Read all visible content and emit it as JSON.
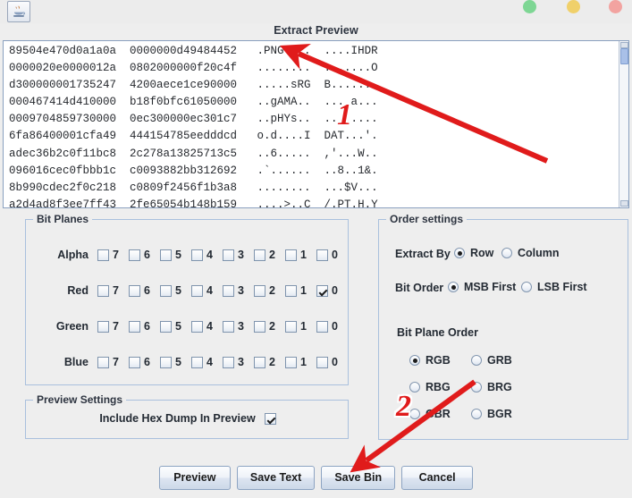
{
  "window": {
    "app_icon": "java-coffee-cup-icon",
    "controls": [
      {
        "name": "minimize",
        "color": "#7ed694"
      },
      {
        "name": "maximize",
        "color": "#f0d06a"
      },
      {
        "name": "close",
        "color": "#f2a3a0"
      }
    ]
  },
  "preview": {
    "title": "Extract Preview",
    "hex_lines": [
      "89504e470d0a1a0a  0000000d49484452   .PNG....  ....IHDR",
      "0000020e0000012a  0802000000f20c4f   ........  .......O",
      "d300000001735247  4200aece1ce90000   .....sRG  B.......",
      "000467414d410000  b18f0bfc61050000   ..gAMA..  ....a...",
      "0009704859730000  0ec300000ec301c7   ..pHYs..  ........",
      "6fa86400001cfa49  444154785eedddcd   o.d....I  DAT...'.",
      "adec36b2c0f11bc8  2c278a13825713c5   ..6.....  ,'...W..",
      "096016cec0fbbb1c  c0093882bb312692   .`......  ..8..1&.",
      "8b990cdec2f0c218  c0809f2456f1b3a8   ........  ...$V...",
      "a2d4ad8f3ee7ff43  2fe65054b148b159   ....>..C  /.PT.H.Y"
    ],
    "scrollbar": "vertical-scrollbar"
  },
  "bit_planes": {
    "legend": "Bit Planes",
    "bit_labels": [
      "7",
      "6",
      "5",
      "4",
      "3",
      "2",
      "1",
      "0"
    ],
    "channels": [
      {
        "label": "Alpha",
        "checked": [
          false,
          false,
          false,
          false,
          false,
          false,
          false,
          false
        ]
      },
      {
        "label": "Red",
        "checked": [
          false,
          false,
          false,
          false,
          false,
          false,
          false,
          true
        ]
      },
      {
        "label": "Green",
        "checked": [
          false,
          false,
          false,
          false,
          false,
          false,
          false,
          false
        ]
      },
      {
        "label": "Blue",
        "checked": [
          false,
          false,
          false,
          false,
          false,
          false,
          false,
          false
        ]
      }
    ]
  },
  "order_settings": {
    "legend": "Order settings",
    "extract_by": {
      "label": "Extract By",
      "options": [
        "Row",
        "Column"
      ],
      "selected": "Row"
    },
    "bit_order": {
      "label": "Bit Order",
      "options": [
        "MSB First",
        "LSB First"
      ],
      "selected": "MSB First"
    },
    "bit_plane_order": {
      "label": "Bit Plane Order",
      "options": [
        "RGB",
        "GRB",
        "RBG",
        "BRG",
        "GBR",
        "BGR"
      ],
      "selected": "RGB"
    }
  },
  "preview_settings": {
    "legend": "Preview Settings",
    "include_hex_dump": {
      "label": "Include Hex Dump In Preview",
      "checked": true
    }
  },
  "buttons": [
    {
      "label": "Preview"
    },
    {
      "label": "Save Text"
    },
    {
      "label": "Save Bin"
    },
    {
      "label": "Cancel"
    }
  ],
  "annotations": {
    "marker_1": "1",
    "marker_2": "2",
    "arrow_color": "#e01b1b"
  }
}
